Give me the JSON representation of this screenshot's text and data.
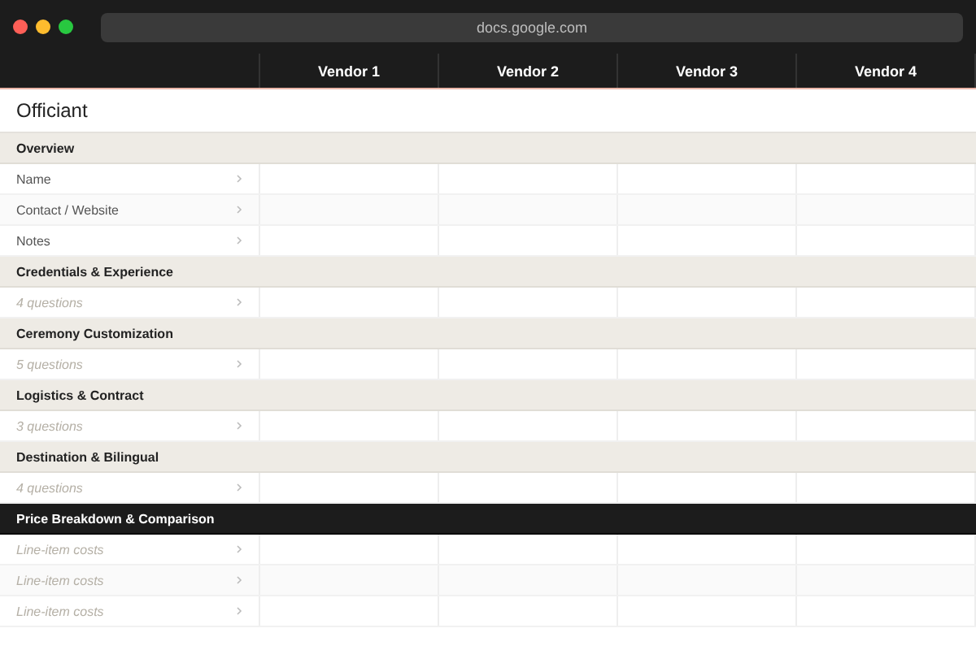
{
  "browser": {
    "url": "docs.google.com"
  },
  "table": {
    "columns": [
      "Vendor 1",
      "Vendor 2",
      "Vendor 3",
      "Vendor 4"
    ],
    "title": "Officiant",
    "rows": [
      {
        "kind": "section",
        "label": "Overview"
      },
      {
        "kind": "item",
        "label": "Name"
      },
      {
        "kind": "item",
        "label": "Contact / Website"
      },
      {
        "kind": "item",
        "label": "Notes"
      },
      {
        "kind": "section",
        "label": "Credentials & Experience"
      },
      {
        "kind": "summary",
        "label": "4 questions"
      },
      {
        "kind": "section",
        "label": "Ceremony Customization"
      },
      {
        "kind": "summary",
        "label": "5 questions"
      },
      {
        "kind": "section",
        "label": "Logistics & Contract"
      },
      {
        "kind": "summary",
        "label": "3 questions"
      },
      {
        "kind": "section",
        "label": "Destination & Bilingual"
      },
      {
        "kind": "summary",
        "label": "4 questions"
      },
      {
        "kind": "section-dark",
        "label": "Price Breakdown & Comparison"
      },
      {
        "kind": "summary",
        "label": "Line-item costs"
      },
      {
        "kind": "summary",
        "label": "Line-item costs"
      },
      {
        "kind": "summary",
        "label": "Line-item costs"
      }
    ]
  }
}
